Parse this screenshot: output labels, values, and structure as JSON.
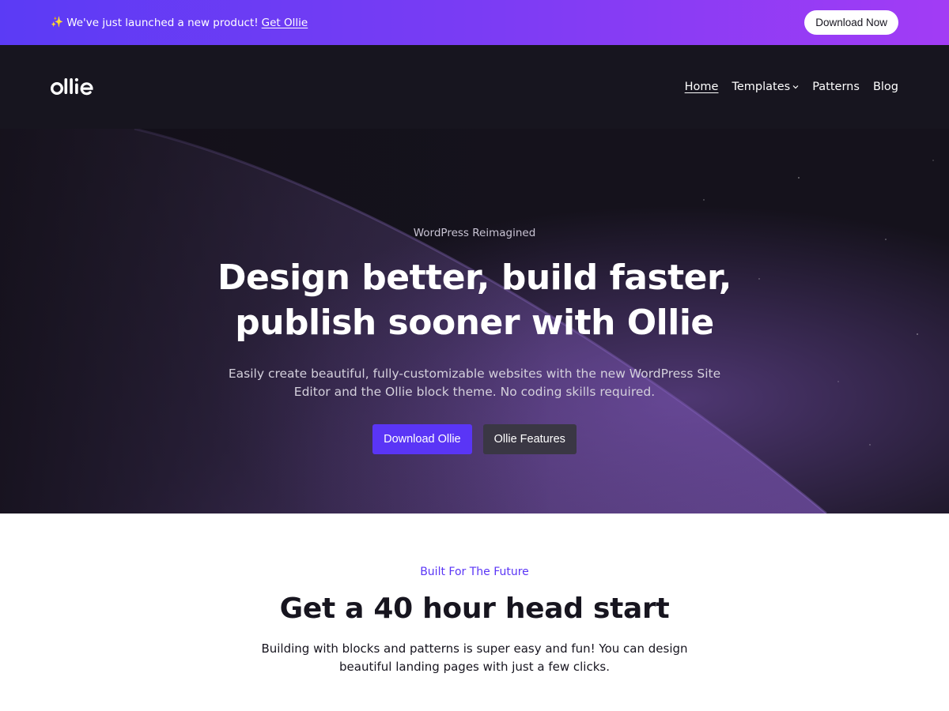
{
  "announcement": {
    "text": "We've just launched a new product!",
    "link_text": "Get Ollie",
    "button_label": "Download Now",
    "icon": "sparkle-icon"
  },
  "header": {
    "logo_text": "ollie",
    "nav": [
      {
        "label": "Home",
        "active": true
      },
      {
        "label": "Templates",
        "has_dropdown": true
      },
      {
        "label": "Patterns"
      },
      {
        "label": "Blog"
      }
    ]
  },
  "hero": {
    "eyebrow": "WordPress Reimagined",
    "title": "Design better, build faster, publish sooner with Ollie",
    "subtitle": "Easily create beautiful, fully-customizable websites with the new WordPress Site Editor and the Ollie block theme. No coding skills required.",
    "primary_button": "Download Ollie",
    "secondary_button": "Ollie Features"
  },
  "features": {
    "kicker": "Built For The Future",
    "heading": "Get a 40 hour head start",
    "text": "Building with blocks and patterns is super easy and fun! You can design beautiful landing pages with just a few clicks."
  },
  "colors": {
    "accent": "#5a35f6",
    "header_bg": "#17151f",
    "announce_gradient_start": "#5b3bf5",
    "announce_gradient_end": "#a23cf5"
  }
}
